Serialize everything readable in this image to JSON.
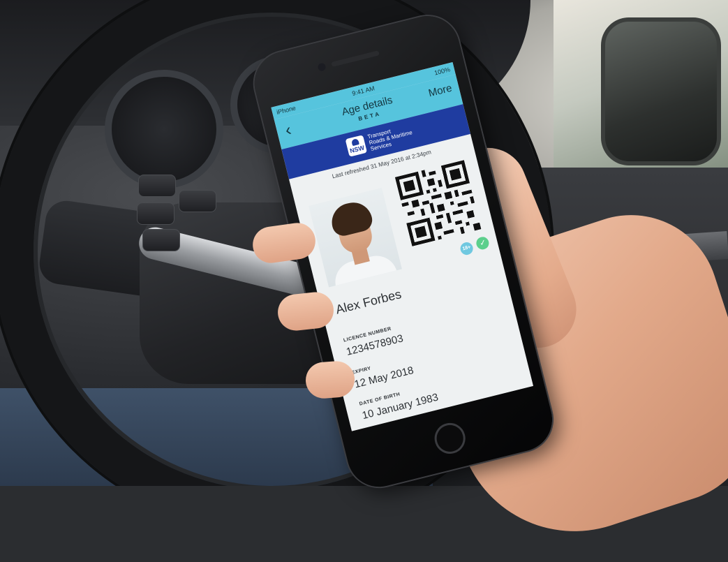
{
  "status": {
    "carrier": "iPhone",
    "time": "9:41 AM",
    "battery": "100%"
  },
  "nav": {
    "back_icon": "chevron-left-icon",
    "title": "Age details",
    "subtitle": "BETA",
    "more_label": "More"
  },
  "brand": {
    "logo_text": "NSW",
    "line1": "Transport",
    "line2": "Roads & Maritime",
    "line3": "Services"
  },
  "card": {
    "refreshed": "Last refreshed 31 May 2016 at 2:34pm",
    "badge": "18+",
    "verified_icon": "check-icon",
    "name": "Alex Forbes",
    "licence_label": "LICENCE NUMBER",
    "licence_number": "1234578903",
    "expiry_label": "EXPIRY",
    "expiry": "12 May 2018",
    "dob_label": "DATE OF BIRTH",
    "dob": "10 January 1983"
  },
  "colors": {
    "header": "#56c4dd",
    "brand_bar": "#1f3ca0",
    "badge": "#6fc8e0",
    "verified": "#5ccf8c"
  }
}
